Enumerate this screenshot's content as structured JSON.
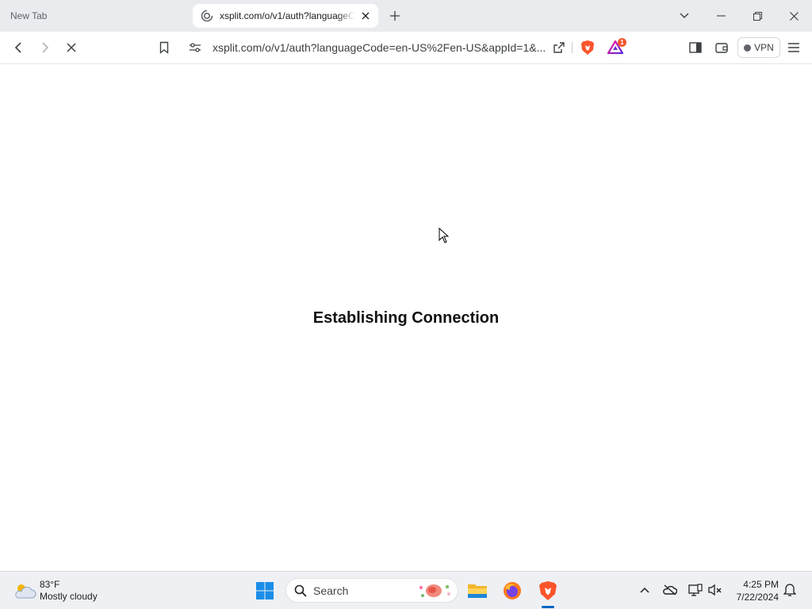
{
  "browser": {
    "tabs": [
      {
        "label": "New Tab",
        "active": false
      },
      {
        "label": "xsplit.com/o/v1/auth?languageCode=en-US",
        "active": true
      }
    ],
    "url": "xsplit.com/o/v1/auth?languageCode=en-US%2Fen-US&appId=1&...",
    "vpn_label": "VPN",
    "alert_count": "1"
  },
  "page": {
    "status_message": "Establishing Connection"
  },
  "taskbar": {
    "weather": {
      "temp": "83°F",
      "desc": "Mostly cloudy"
    },
    "search_label": "Search",
    "clock": {
      "time": "4:25 PM",
      "date": "7/22/2024"
    }
  },
  "colors": {
    "brave_orange": "#fb542b",
    "tab_strip_bg": "#e9ebee",
    "accent_blue": "#0067c0"
  }
}
